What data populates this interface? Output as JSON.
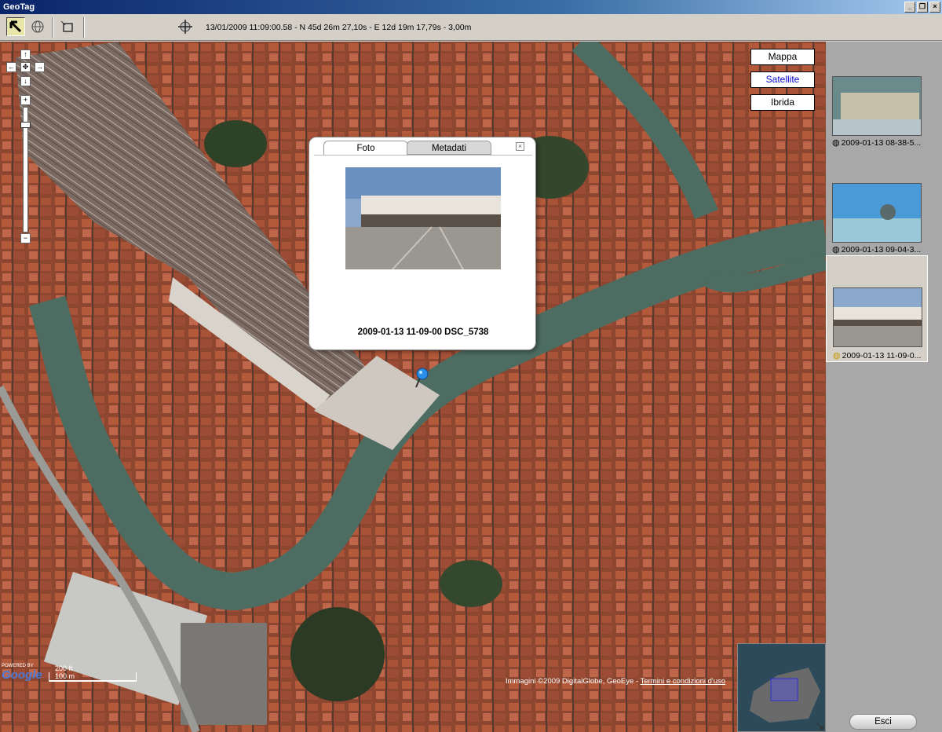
{
  "window": {
    "title": "GeoTag",
    "min": "_",
    "max": "❐",
    "close": "×"
  },
  "toolbar": {
    "coords": "13/01/2009 11:09:00.58 - N 45d 26m 27,10s - E 12d 19m 17,79s - 3,00m"
  },
  "map": {
    "types": [
      "Mappa",
      "Satellite",
      "Ibrida"
    ],
    "selected_type": "Satellite",
    "nav": {
      "up": "↑",
      "left": "←",
      "center": "✥",
      "right": "→",
      "down": "↓",
      "zoom_in": "+",
      "zoom_out": "−"
    },
    "attribution_prefix": "Immagini ©2009 DigitalGlobe, GeoEye - ",
    "attribution_link": "Termini e condizioni d'uso",
    "scale_ft": "200 ft",
    "scale_m": "100 m",
    "powered_by": "POWERED BY",
    "google_logo": "Google"
  },
  "popup": {
    "tab_foto": "Foto",
    "tab_metadati": "Metadati",
    "close": "×",
    "caption": "2009-01-13 11-09-00 DSC_5738"
  },
  "panel": {
    "thumbs": [
      {
        "label": "2009-01-13 08-38-5..."
      },
      {
        "label": "2009-01-13 09-04-3..."
      },
      {
        "label": "2009-01-13 11-09-0..."
      }
    ],
    "exit_label": "Esci"
  },
  "colors": {
    "title_bar": "#0a246a",
    "map_roofs": "#9a4a30",
    "canal": "#4a6a60",
    "panel": "#a8a8a8"
  }
}
